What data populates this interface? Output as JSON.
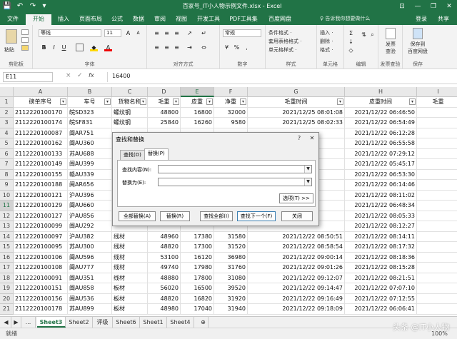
{
  "app": {
    "title": "百家号_IT小人物示例文件.xlsx - Excel",
    "quick_access": [
      "💾",
      "↶",
      "↷",
      "▾"
    ],
    "window_buttons": [
      "⊡",
      "—",
      "❐",
      "✕"
    ]
  },
  "tabs": [
    "文件",
    "开始",
    "插入",
    "页面布局",
    "公式",
    "数据",
    "审阅",
    "视图",
    "开发工具",
    "PDF工具集",
    "百度网盘"
  ],
  "active_tab": "开始",
  "tell_me": "♀ 告诉我你想要做什么",
  "user": "登录",
  "share": "共享",
  "ribbon": {
    "clipboard": {
      "paste": "粘贴",
      "label": "剪贴板"
    },
    "font": {
      "name": "等线",
      "size": "11",
      "label": "字体",
      "bold": "B",
      "italic": "I",
      "underline": "U",
      "font_color_label": "A"
    },
    "alignment": {
      "label": "对齐方式"
    },
    "number": {
      "format": "常规",
      "label": "数字"
    },
    "styles": {
      "cond": "条件格式 ·",
      "table": "套用表格格式 ·",
      "cell": "单元格样式 ·",
      "label": "样式"
    },
    "cells": {
      "insert": "插入 ·",
      "delete": "删除 ·",
      "format": "格式 ·",
      "label": "单元格"
    },
    "editing": {
      "label": "编辑"
    },
    "invoice": {
      "btn": "发票\n查验",
      "label": "发票查验"
    },
    "save": {
      "btn": "保存到\n百度网盘",
      "label": "保存"
    }
  },
  "formula_bar": {
    "name_box": "E11",
    "value": "16400",
    "cancel": "×",
    "enter": "✓",
    "fx": "fx"
  },
  "columns": [
    "A",
    "B",
    "C",
    "D",
    "E",
    "F",
    "G",
    "H",
    "I"
  ],
  "header_row": [
    "磅单序号",
    "车号",
    "货物名称",
    "毛重",
    "皮重",
    "净重",
    "毛重时间",
    "皮重时间",
    "毛重"
  ],
  "rows": [
    {
      "n": "2",
      "c": [
        "2112220100170",
        "皖SD323",
        "螺纹钢",
        "48800",
        "16800",
        "32000",
        "2021/12/25 08:01:08",
        "2021/12/22 06:46:50",
        ""
      ]
    },
    {
      "n": "3",
      "c": [
        "2112220100174",
        "皖SF831",
        "螺纹钢",
        "25840",
        "16260",
        "9580",
        "2021/12/25 08:02:33",
        "2021/12/22 06:54:49",
        ""
      ]
    },
    {
      "n": "4",
      "c": [
        "2112220100087",
        "闽AR751",
        "",
        "",
        "",
        "",
        "",
        "2021/12/22 06:12:28",
        ""
      ]
    },
    {
      "n": "5",
      "c": [
        "2112220100162",
        "闽AU360",
        "",
        "",
        "",
        "",
        "",
        "2021/12/22 06:55:58",
        ""
      ]
    },
    {
      "n": "6",
      "c": [
        "2112220100133",
        "苏AU688",
        "",
        "",
        "",
        "",
        "",
        "2021/12/22 07:29:12",
        ""
      ]
    },
    {
      "n": "7",
      "c": [
        "2112220100149",
        "闽AU399",
        "",
        "",
        "",
        "",
        "",
        "2021/12/22 05:45:17",
        ""
      ]
    },
    {
      "n": "8",
      "c": [
        "2112220100155",
        "赣AU339",
        "",
        "",
        "",
        "",
        "",
        "2021/12/22 06:53:30",
        ""
      ]
    },
    {
      "n": "9",
      "c": [
        "2112220100188",
        "闽AR656",
        "",
        "",
        "",
        "",
        "",
        "2021/12/22 06:14:46",
        ""
      ]
    },
    {
      "n": "10",
      "c": [
        "2112220100121",
        "沪AU396",
        "",
        "",
        "",
        "",
        "",
        "2021/12/22 08:11:02",
        ""
      ]
    },
    {
      "n": "11",
      "c": [
        "2112220100129",
        "闽AU660",
        "",
        "",
        "",
        "",
        "",
        "2021/12/22 06:48:34",
        ""
      ]
    },
    {
      "n": "12",
      "c": [
        "2112220100127",
        "沪AU856",
        "",
        "",
        "",
        "",
        "",
        "2021/12/22 08:05:33",
        ""
      ]
    },
    {
      "n": "13",
      "c": [
        "2112220100099",
        "闽AU292",
        "",
        "",
        "",
        "",
        "",
        "2021/12/22 08:12:27",
        ""
      ]
    },
    {
      "n": "14",
      "c": [
        "2112220100097",
        "沪AU382",
        "线材",
        "48960",
        "17380",
        "31580",
        "2021/12/22 08:50:51",
        "2021/12/22 08:14:11",
        ""
      ]
    },
    {
      "n": "15",
      "c": [
        "2112220100095",
        "苏AU300",
        "线材",
        "48820",
        "17300",
        "31520",
        "2021/12/22 08:58:54",
        "2021/12/22 08:17:32",
        ""
      ]
    },
    {
      "n": "16",
      "c": [
        "2112220100106",
        "闽AU596",
        "线材",
        "53100",
        "16120",
        "36980",
        "2021/12/22 09:00:14",
        "2021/12/22 08:18:36",
        ""
      ]
    },
    {
      "n": "17",
      "c": [
        "2112220100108",
        "闽AU777",
        "线材",
        "49740",
        "17980",
        "31760",
        "2021/12/22 09:01:26",
        "2021/12/22 08:15:28",
        ""
      ]
    },
    {
      "n": "18",
      "c": [
        "2112220100091",
        "闽AU351",
        "线材",
        "48880",
        "17800",
        "31080",
        "2021/12/22 09:12:07",
        "2021/12/22 08:21:51",
        ""
      ]
    },
    {
      "n": "19",
      "c": [
        "2112220100151",
        "闽AU858",
        "板材",
        "56020",
        "16500",
        "39520",
        "2021/12/22 09:14:47",
        "2021/12/22 07:07:10",
        ""
      ]
    },
    {
      "n": "20",
      "c": [
        "2112220100156",
        "闽AU536",
        "板材",
        "48820",
        "16820",
        "31920",
        "2021/12/22 09:16:49",
        "2021/12/22 07:12:55",
        ""
      ]
    },
    {
      "n": "21",
      "c": [
        "2112220100178",
        "苏AU899",
        "板材",
        "48980",
        "17040",
        "31940",
        "2021/12/22 09:18:09",
        "2021/12/22 06:06:41",
        ""
      ]
    }
  ],
  "dialog": {
    "title": "查找和替换",
    "help": "?",
    "close": "✕",
    "tab_find": "查找(D)",
    "tab_replace": "替换(P)",
    "find_label": "查找内容(N):",
    "replace_label": "替换为(E):",
    "options": "选项(T) >>",
    "btn_replace_all": "全部替换(A)",
    "btn_replace": "替换(R)",
    "btn_find_all": "查找全部(I)",
    "btn_find_next": "查找下一个(F)",
    "btn_close": "关闭"
  },
  "sheet_tabs": [
    "Sheet3",
    "Sheet2",
    "评级",
    "Sheet6",
    "Sheet1",
    "Sheet4"
  ],
  "active_sheet": "Sheet3",
  "status": {
    "ready": "就绪",
    "zoom": "100%"
  },
  "watermark": "头条 @IT小人物"
}
